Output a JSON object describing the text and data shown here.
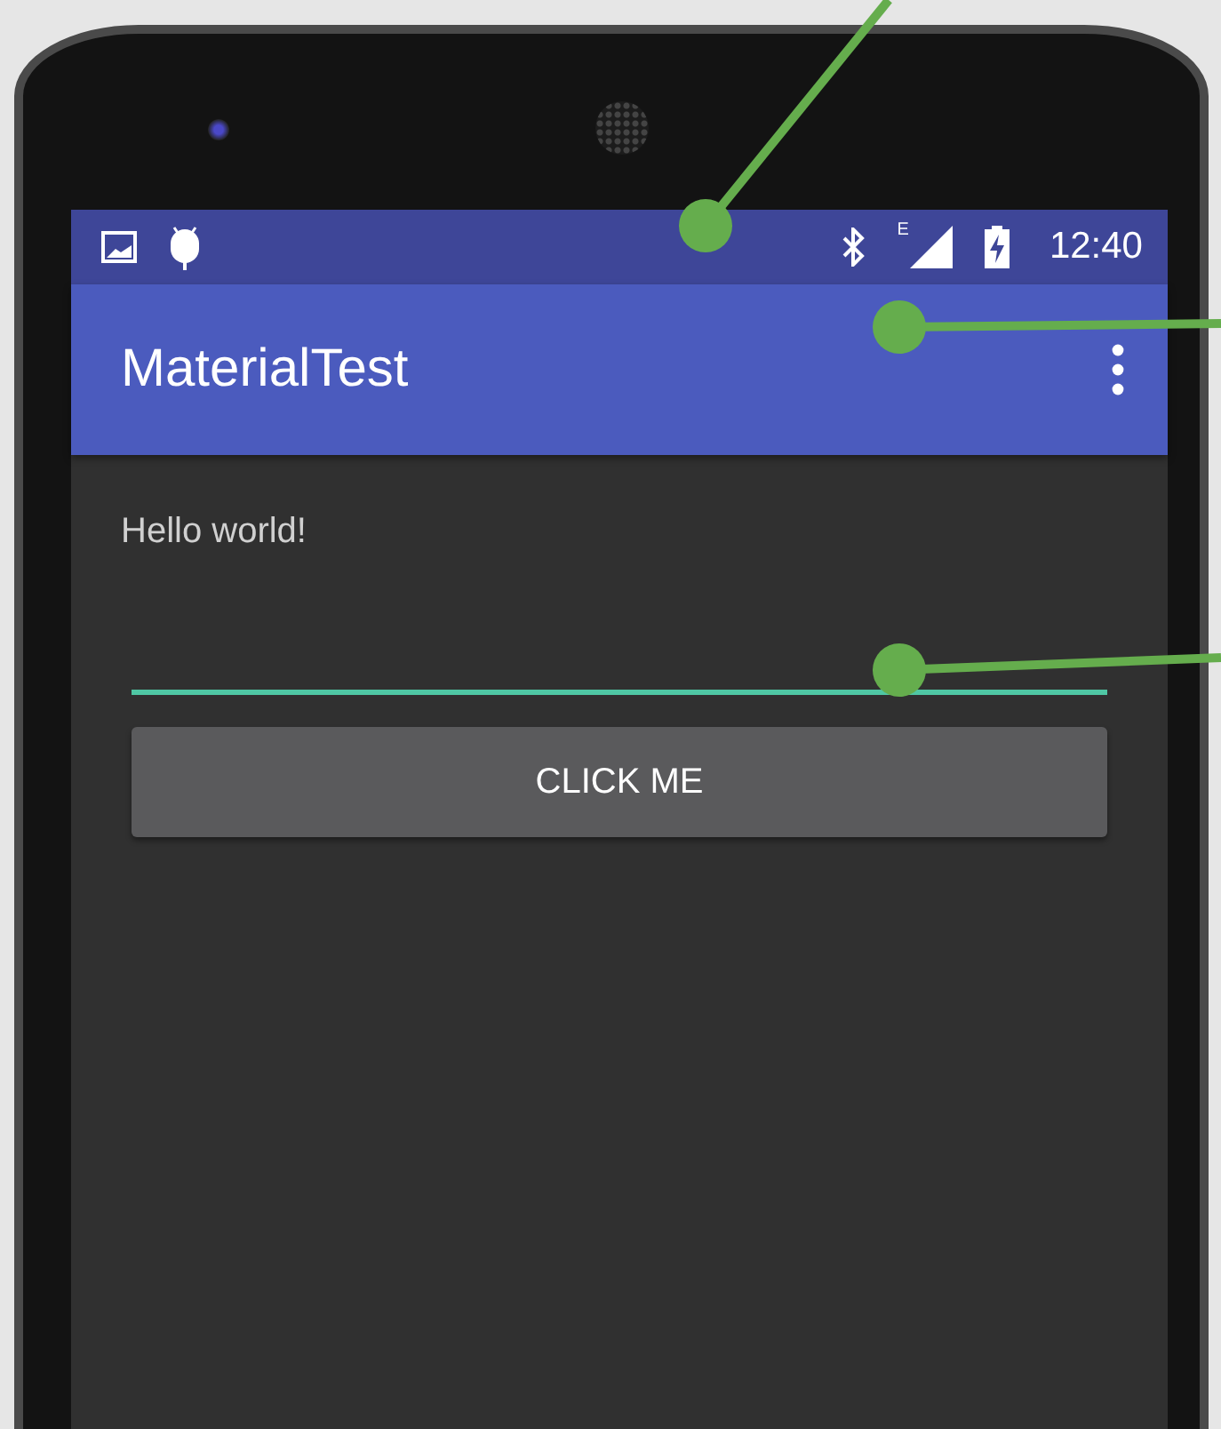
{
  "status_bar": {
    "network_type": "E",
    "time": "12:40"
  },
  "app_bar": {
    "title": "MaterialTest"
  },
  "content": {
    "text": "Hello world!",
    "field": {
      "focused": true
    },
    "button": {
      "label": "CLICK ME"
    }
  }
}
